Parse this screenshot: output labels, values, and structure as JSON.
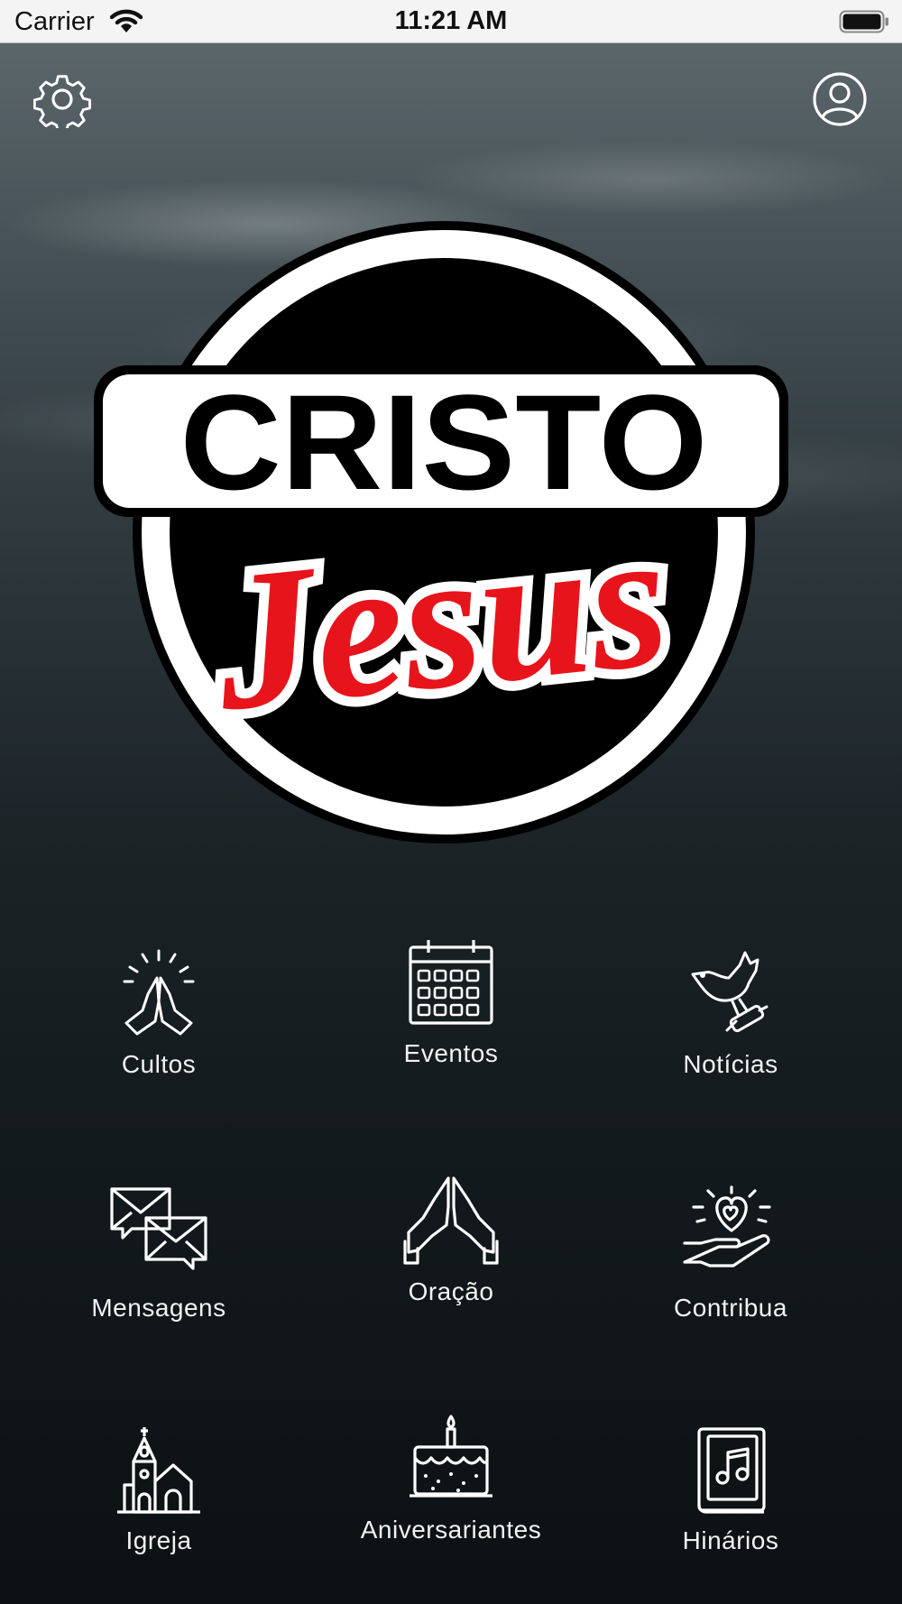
{
  "status_bar": {
    "carrier": "Carrier",
    "time": "11:21 AM"
  },
  "header": {
    "settings_icon": "gear-icon",
    "profile_icon": "user-circle-icon"
  },
  "logo": {
    "top_text": "CRISTO",
    "script_text": "Jesus",
    "colors": {
      "script": "#e8141b",
      "ring": "#000000",
      "fill": "#ffffff"
    }
  },
  "menu": {
    "items": [
      {
        "label": "Cultos",
        "icon": "praying-hands-icon"
      },
      {
        "label": "Eventos",
        "icon": "calendar-icon"
      },
      {
        "label": "Notícias",
        "icon": "dove-icon"
      },
      {
        "label": "Mensagens",
        "icon": "envelopes-icon"
      },
      {
        "label": "Oração",
        "icon": "prayer-icon"
      },
      {
        "label": "Contribua",
        "icon": "heart-hand-icon"
      },
      {
        "label": "Igreja",
        "icon": "church-icon"
      },
      {
        "label": "Aniversariantes",
        "icon": "cake-icon"
      },
      {
        "label": "Hinários",
        "icon": "hymnal-book-icon"
      }
    ]
  }
}
